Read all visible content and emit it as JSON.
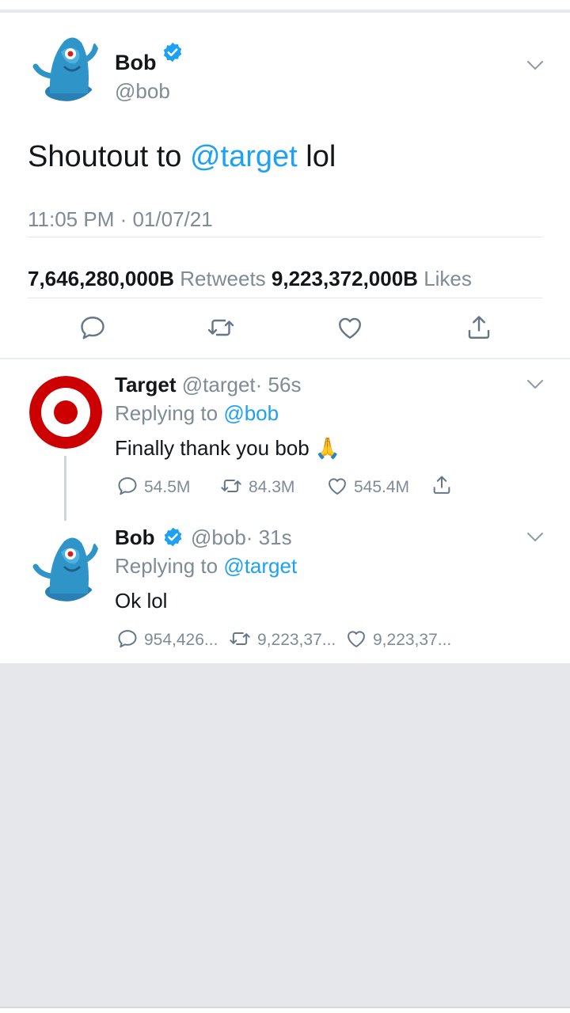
{
  "main_tweet": {
    "name": "Bob",
    "handle": "@bob",
    "text_before": "Shoutout to ",
    "mention": "@target",
    "text_after": " lol",
    "timestamp": "11:05 PM · 01/07/21",
    "retweets_count": "7,646,280,000B",
    "retweets_label": "Retweets",
    "likes_count": "9,223,372,000B",
    "likes_label": "Likes"
  },
  "replies": [
    {
      "name": "Target",
      "handle": "@target",
      "time": "· 56s",
      "replying_to_label": "Replying to",
      "replying_to": "@bob",
      "text": "Finally thank you bob 🙏",
      "comments": "54.5M",
      "retweets": "84.3M",
      "likes": "545.4M"
    },
    {
      "name": "Bob",
      "handle": "@bob",
      "time": "· 31s",
      "replying_to_label": "Replying to",
      "replying_to": "@target",
      "text": "Ok lol",
      "comments": "954,426...",
      "retweets": "9,223,37...",
      "likes": "9,223,37..."
    }
  ],
  "icons": {
    "verified": "verified-badge-icon",
    "chevron": "chevron-down-icon",
    "reply": "reply-icon",
    "retweet": "retweet-icon",
    "like": "heart-icon",
    "share": "share-icon"
  },
  "colors": {
    "accent": "#1da1f2",
    "secondary_text": "#7f8b95",
    "target_red": "#cc0000",
    "bob_blue": "#2f95c8",
    "background": "#e6e7eb"
  }
}
